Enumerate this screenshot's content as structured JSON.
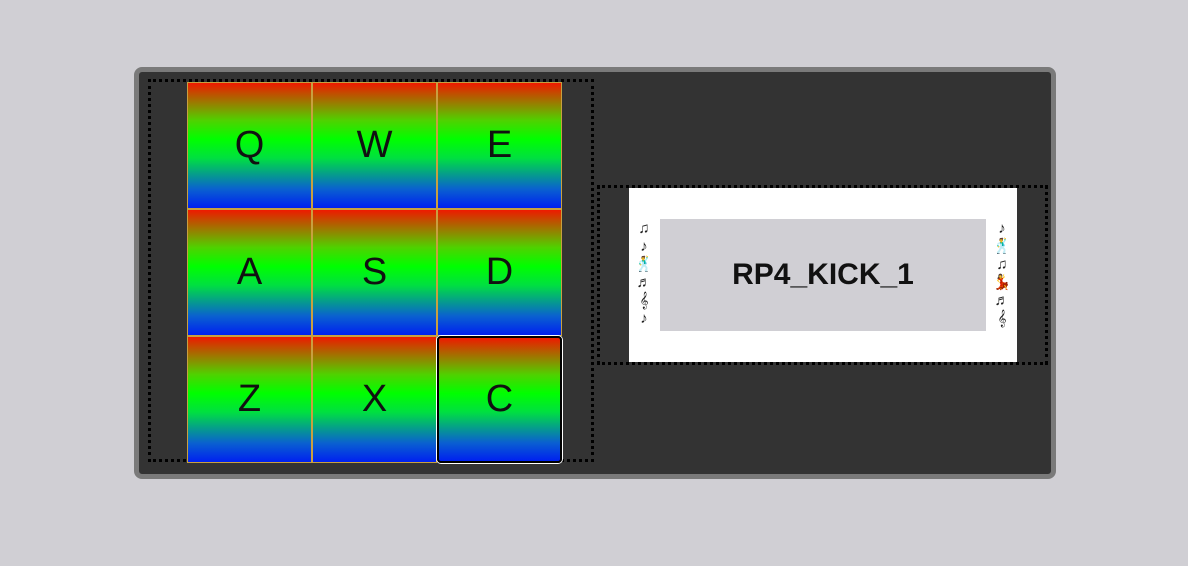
{
  "pads": [
    {
      "key": "Q"
    },
    {
      "key": "W"
    },
    {
      "key": "E"
    },
    {
      "key": "A"
    },
    {
      "key": "S"
    },
    {
      "key": "D"
    },
    {
      "key": "Z"
    },
    {
      "key": "X"
    },
    {
      "key": "C"
    }
  ],
  "display": {
    "text": "RP4_KICK_1"
  },
  "decor": {
    "left_icon": "music-notes-dancers-icon",
    "right_icon": "music-notes-dancers-icon"
  },
  "colors": {
    "page_background": "#d0cfd4",
    "machine_background": "#333333",
    "pad_gradient_top": "#ee1a00",
    "pad_gradient_middle": "#00ff00",
    "pad_gradient_bottom": "#0020f0"
  }
}
